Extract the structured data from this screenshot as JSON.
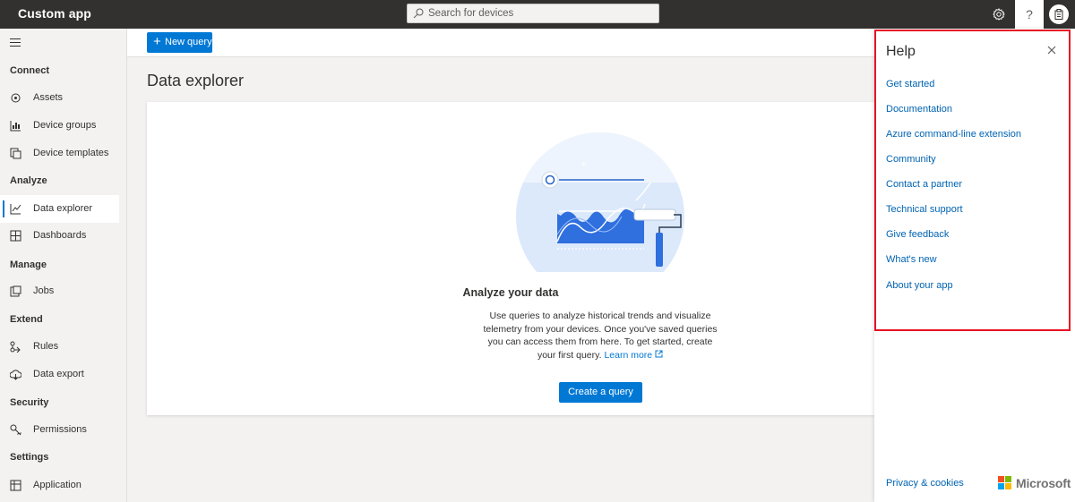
{
  "header": {
    "app_title": "Custom app",
    "search_placeholder": "Search for devices",
    "help_glyph": "?"
  },
  "sidebar": {
    "sections": [
      {
        "label": "Connect",
        "items": [
          {
            "label": "Assets",
            "icon": "assets-icon"
          },
          {
            "label": "Device groups",
            "icon": "device-groups-icon"
          },
          {
            "label": "Device templates",
            "icon": "device-templates-icon"
          }
        ]
      },
      {
        "label": "Analyze",
        "items": [
          {
            "label": "Data explorer",
            "icon": "chart-line-icon",
            "active": true
          },
          {
            "label": "Dashboards",
            "icon": "dashboard-icon"
          }
        ]
      },
      {
        "label": "Manage",
        "items": [
          {
            "label": "Jobs",
            "icon": "jobs-icon"
          }
        ]
      },
      {
        "label": "Extend",
        "items": [
          {
            "label": "Rules",
            "icon": "rules-icon"
          },
          {
            "label": "Data export",
            "icon": "data-export-icon"
          }
        ]
      },
      {
        "label": "Security",
        "items": [
          {
            "label": "Permissions",
            "icon": "key-icon"
          }
        ]
      },
      {
        "label": "Settings",
        "items": [
          {
            "label": "Application",
            "icon": "application-icon"
          }
        ]
      }
    ]
  },
  "toolbar": {
    "new_query_label": "New query"
  },
  "main": {
    "page_title": "Data explorer",
    "empty_state": {
      "heading": "Analyze your data",
      "description": "Use queries to analyze historical trends and visualize telemetry from your devices. Once you've saved queries you can access them from here. To get started, create your first query.",
      "learn_more": "Learn more",
      "create_button": "Create a query"
    }
  },
  "help_panel": {
    "title": "Help",
    "links": [
      "Get started",
      "Documentation",
      "Azure command-line extension",
      "Community",
      "Contact a partner",
      "Technical support",
      "Give feedback",
      "What's new",
      "About your app"
    ],
    "privacy": "Privacy & cookies",
    "brand": "Microsoft"
  },
  "colors": {
    "accent": "#0078d4",
    "topbar": "#323130",
    "highlight": "#e81123"
  }
}
